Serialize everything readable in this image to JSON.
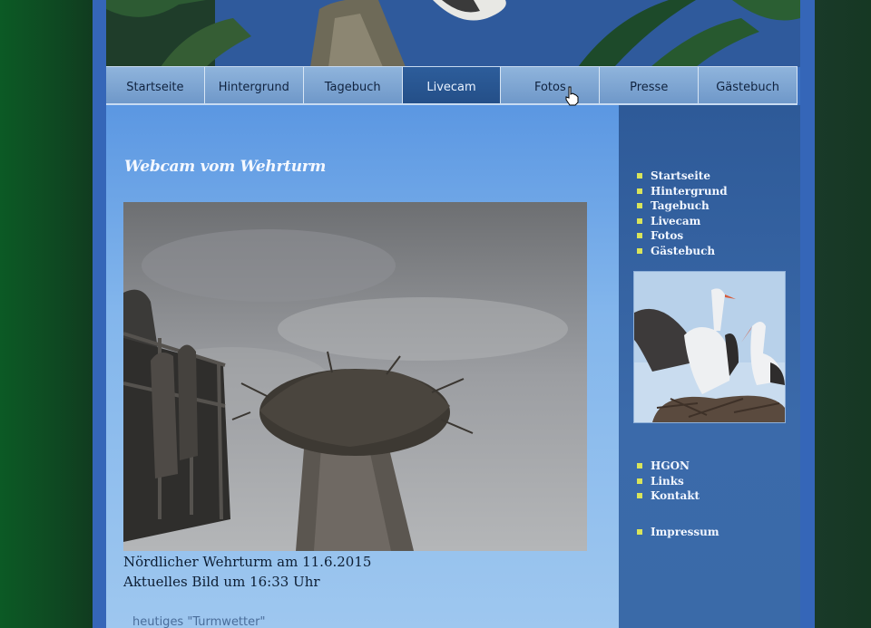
{
  "nav": {
    "items": [
      {
        "label": "Startseite"
      },
      {
        "label": "Hintergrund"
      },
      {
        "label": "Tagebuch"
      },
      {
        "label": "Livecam",
        "active": true
      },
      {
        "label": "Fotos"
      },
      {
        "label": "Presse"
      },
      {
        "label": "Gästebuch"
      }
    ]
  },
  "main": {
    "title": "Webcam vom Wehrturm",
    "caption_line1": "Nördlicher Wehrturm am 11.6.2015",
    "caption_line2": "Aktuelles Bild um 16:33 Uhr",
    "weather_text": "heutiges \"Turmwetter\""
  },
  "sidebar": {
    "nav_links": [
      "Startseite",
      "Hintergrund",
      "Tagebuch",
      "Livecam",
      "Fotos",
      "Gästebuch"
    ],
    "extra_links": [
      "HGON",
      "Links",
      "Kontakt"
    ],
    "imprint_link": "Impressum"
  },
  "colors": {
    "nav_active": "#244f88",
    "sidebar_bg": "#2e5a98",
    "bullet": "#d9e45a",
    "main_bg": "#83b6ec"
  }
}
